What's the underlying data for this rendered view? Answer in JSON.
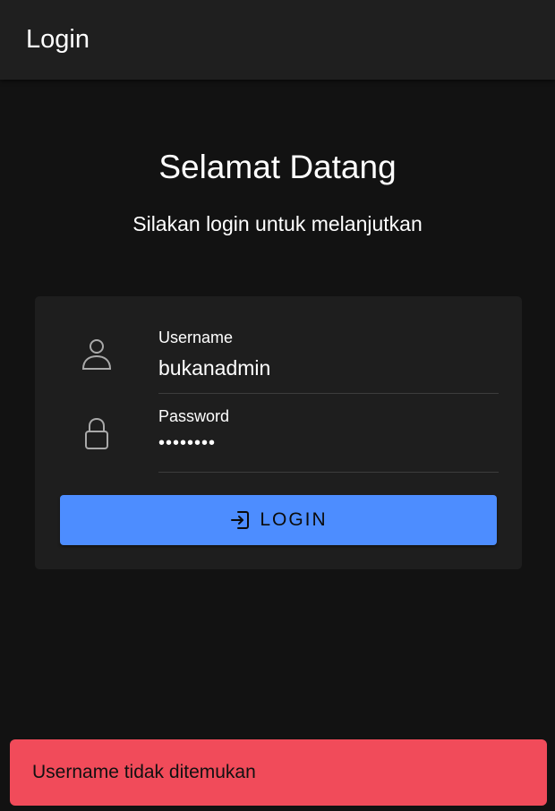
{
  "header": {
    "title": "Login"
  },
  "welcome": {
    "title": "Selamat Datang",
    "subtitle": "Silakan login untuk melanjutkan"
  },
  "form": {
    "username": {
      "label": "Username",
      "value": "bukanadmin",
      "icon": "person-icon"
    },
    "password": {
      "label": "Password",
      "value": "••••••••",
      "icon": "lock-icon"
    },
    "login_button": {
      "label": "LOGIN",
      "icon": "log-in-icon"
    }
  },
  "toast": {
    "message": "Username tidak ditemukan"
  },
  "colors": {
    "background": "#121212",
    "toolbar": "#1f1f1f",
    "card": "#1e1e1e",
    "primary": "#4d8dff",
    "danger": "#f14b5a"
  }
}
